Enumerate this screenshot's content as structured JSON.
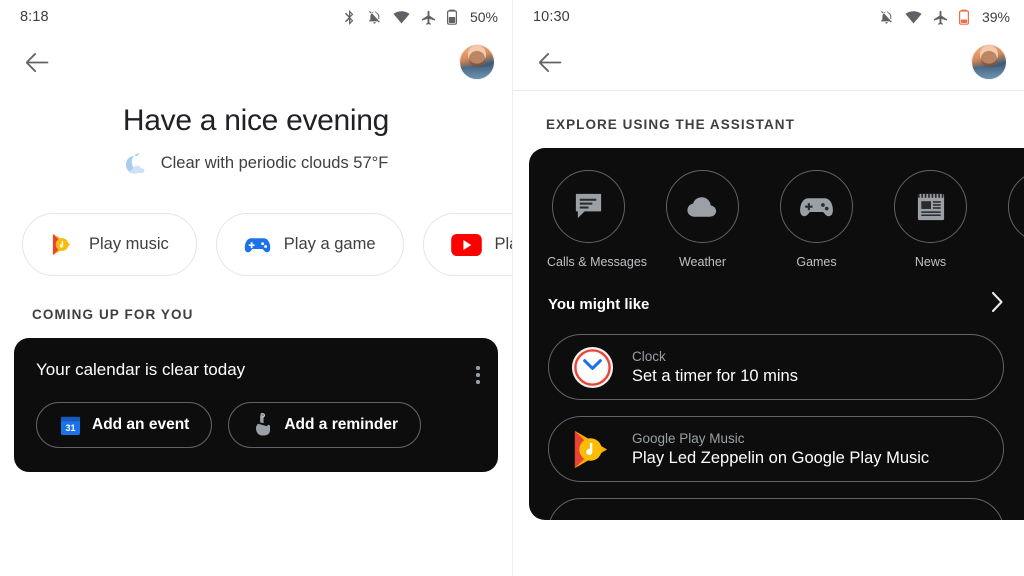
{
  "left_panel": {
    "status": {
      "time": "8:18",
      "battery": "50%",
      "icons": [
        "bluetooth-icon",
        "mute-icon",
        "wifi-icon",
        "airplane-mode-icon",
        "battery-icon"
      ]
    },
    "appbar": {
      "back": "back-arrow-icon",
      "avatar": "user-avatar"
    },
    "greeting": {
      "title": "Have a nice evening",
      "weather_icon": "crescent-moon-icon",
      "weather": "Clear with periodic clouds 57°F"
    },
    "chips": [
      {
        "label": "Play music",
        "icon": "google-play-music-icon"
      },
      {
        "label": "Play a game",
        "icon": "gamepad-icon"
      },
      {
        "label": "Pla",
        "icon": "youtube-icon"
      }
    ],
    "section": {
      "header": "COMING UP FOR YOU"
    },
    "calendar_card": {
      "title": "Your calendar is clear today",
      "menu_icon": "overflow-menu-icon",
      "actions": [
        {
          "label": "Add an event",
          "icon": "calendar-31-icon"
        },
        {
          "label": "Add a reminder",
          "icon": "reminder-finger-icon"
        }
      ]
    }
  },
  "right_panel": {
    "status": {
      "time": "10:30",
      "battery": "39%",
      "icons": [
        "mute-icon",
        "wifi-icon",
        "airplane-mode-icon",
        "battery-low-icon"
      ]
    },
    "appbar": {
      "back": "back-arrow-icon",
      "avatar": "user-avatar"
    },
    "section": {
      "header": "EXPLORE USING THE ASSISTANT"
    },
    "categories": [
      {
        "label": "Calls & Messages",
        "icon": "chat-bubble-icon"
      },
      {
        "label": "Weather",
        "icon": "cloud-icon"
      },
      {
        "label": "Games",
        "icon": "gamepad-icon"
      },
      {
        "label": "News",
        "icon": "newspaper-icon"
      },
      {
        "label": "",
        "icon": "partial-category-icon"
      }
    ],
    "you_might_like": {
      "label": "You might like",
      "chevron": "chevron-right-icon"
    },
    "suggestions": [
      {
        "app": "Clock",
        "query": "Set a timer for 10 mins",
        "icon": "clock-icon"
      },
      {
        "app": "Google Play Music",
        "query": "Play Led Zeppelin on Google Play Music",
        "icon": "google-play-music-icon"
      }
    ]
  },
  "colors": {
    "dark_card": "#0d0d0d",
    "text_primary": "#202124",
    "text_secondary": "#3c4043",
    "text_muted": "#9aa0a6",
    "youtube_red": "#ff0000",
    "gamepad_blue": "#1a73e8",
    "clock_red": "#ea4335",
    "play_music_orange": "#ff7043",
    "battery_low_red": "#e8714a"
  }
}
